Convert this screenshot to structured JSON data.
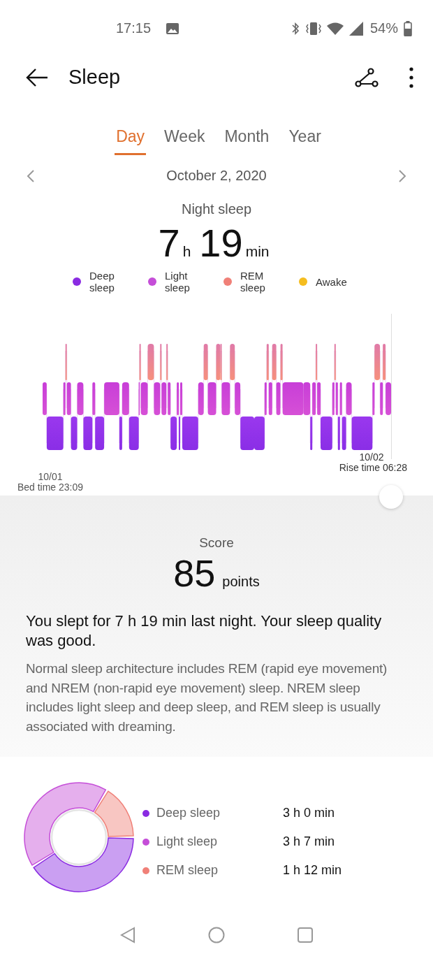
{
  "status_bar": {
    "time": "17:15",
    "battery": "54%"
  },
  "header": {
    "title": "Sleep"
  },
  "tabs": [
    {
      "label": "Day",
      "selected": true
    },
    {
      "label": "Week",
      "selected": false
    },
    {
      "label": "Month",
      "selected": false
    },
    {
      "label": "Year",
      "selected": false
    }
  ],
  "date": "October 2, 2020",
  "summary": {
    "label": "Night sleep",
    "hours": "7",
    "hours_unit": "h",
    "minutes": "19",
    "minutes_unit": "min"
  },
  "legend": [
    {
      "label": "Deep sleep",
      "color": "#8a2be2"
    },
    {
      "label": "Light sleep",
      "color": "#c54ed8"
    },
    {
      "label": "REM sleep",
      "color": "#f08078"
    },
    {
      "label": "Awake",
      "color": "#f5bd1f"
    }
  ],
  "chart": {
    "end_date": "10/02",
    "end_label": "Rise time 06:28",
    "start_date": "10/01",
    "start_label": "Bed time 23:09"
  },
  "score": {
    "label": "Score",
    "value": "85",
    "unit": "points",
    "headline": "You slept for 7 h 19 min last night. Your sleep quality was good.",
    "description": "Normal sleep architecture includes REM (rapid eye movement) and NREM (non-rapid eye movement) sleep. NREM sleep includes light sleep and deep sleep, and REM sleep is usually associated with dreaming."
  },
  "breakdown": {
    "chart_data": {
      "type": "donut",
      "categories": [
        "Deep sleep",
        "Light sleep",
        "REM sleep"
      ],
      "values": [
        41.0,
        42.6,
        16.4
      ]
    },
    "rows": [
      {
        "duration": "3 h 0 min",
        "color": "#8a2be2"
      },
      {
        "duration": "3 h 7 min",
        "color": "#c54ed8"
      },
      {
        "duration": "1 h 12 min",
        "color": "#f08078"
      }
    ]
  }
}
